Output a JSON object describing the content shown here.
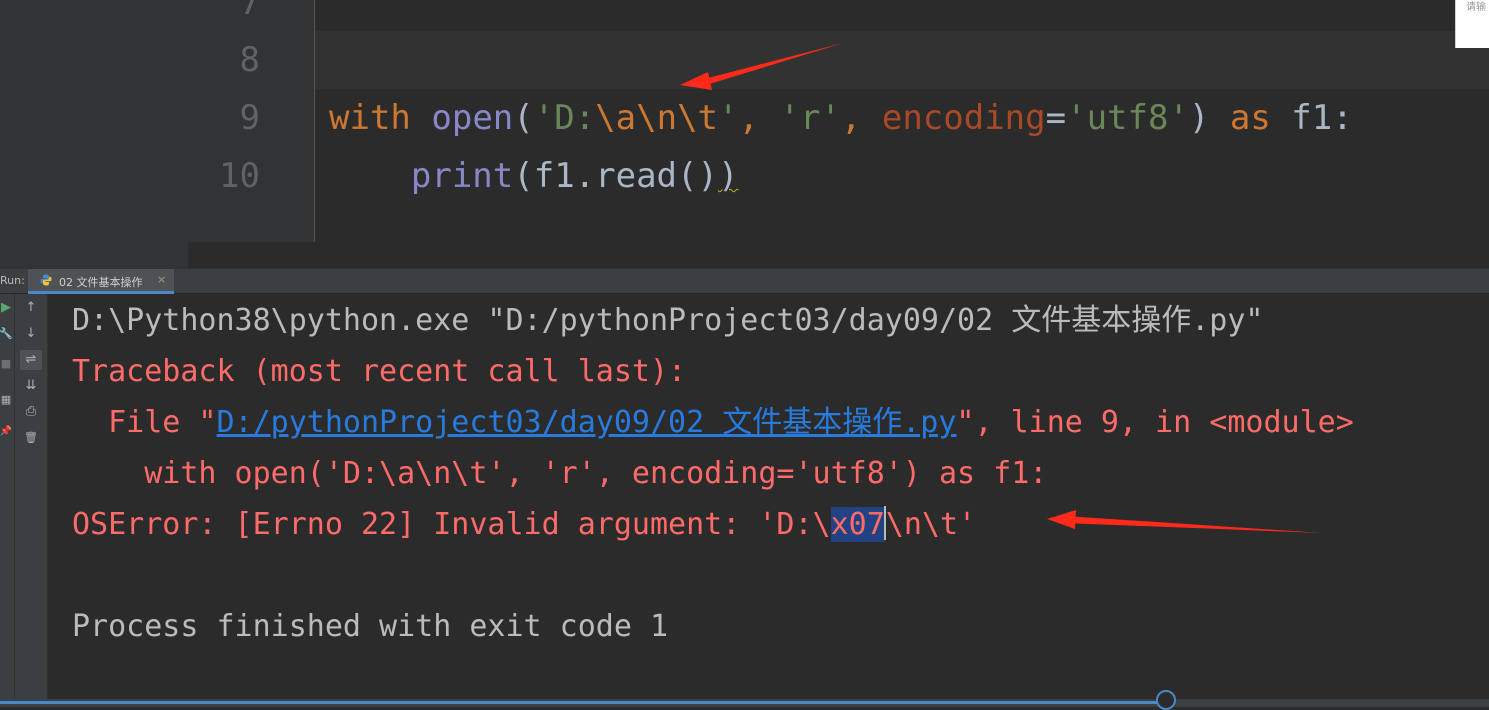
{
  "editor": {
    "line_numbers": [
      "7",
      "8",
      "9",
      "10"
    ],
    "line9": {
      "kw_with": "with",
      "fn_open": "open",
      "p1": "(",
      "s1a": "'D:",
      "e1": "\\a",
      "e2": "\\n",
      "e3": "\\t",
      "s1b": "'",
      "c1": ", ",
      "s2": "'r'",
      "c2": ", ",
      "param": "encoding",
      "eq": "=",
      "s3": "'utf8'",
      "p2": ") ",
      "kw_as": "as",
      "var": " f1:"
    },
    "line10": {
      "indent": "    ",
      "fn_print": "print",
      "pre": "(f1.read()",
      "last": ")"
    },
    "corner_text": "请输"
  },
  "run_panel": {
    "label": "Run:",
    "tab_label": "02 文件基本操作",
    "tab_close": "×",
    "toolbar_col1": {
      "run": "▶",
      "wrench": "🔧",
      "stop": "■",
      "layout": "▦",
      "pin": "📌"
    },
    "toolbar_col2": {
      "up": "↑",
      "down": "↓",
      "wrap": "⇌",
      "scroll_end": "⇊",
      "print": "⎙",
      "trash": "🗑"
    }
  },
  "console": {
    "cmd_line": "D:\\Python38\\python.exe \"D:/pythonProject03/day09/02 文件基本操作.py\"",
    "traceback_header": "Traceback (most recent call last):",
    "file_prefix": "  File \"",
    "file_link": "D:/pythonProject03/day09/02 文件基本操作.py",
    "file_suffix": "\", line 9, in <module>",
    "code_line": "    with open('D:\\a\\n\\t', 'r', encoding='utf8') as f1:",
    "error_prefix": "OSError: [Errno 22] Invalid argument: 'D:\\",
    "error_selected": "x07",
    "error_suffix": "\\n\\t'",
    "exit_line": "Process finished with exit code 1"
  },
  "colors": {
    "keyword": "#cc7832",
    "function": "#8888c6",
    "string": "#6a8759",
    "param": "#aa4926",
    "error_text": "#ff6b68",
    "link": "#287bde",
    "annotation_arrow": "#ff2a1a"
  }
}
